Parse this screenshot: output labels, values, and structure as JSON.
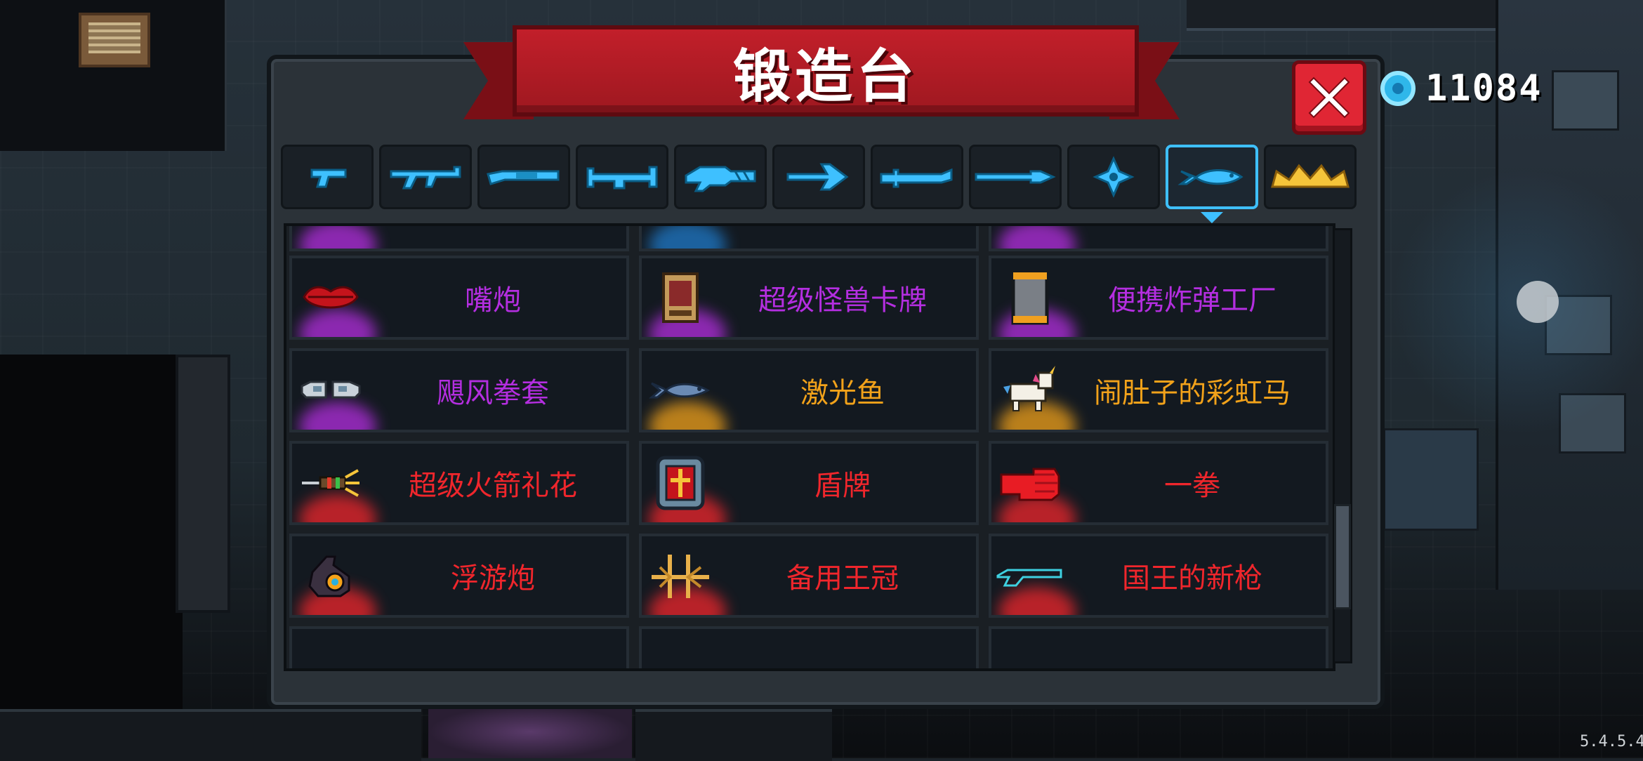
{
  "window": {
    "title": "锻造台"
  },
  "currency": {
    "gems": "11084",
    "color": "#2fb7ea"
  },
  "close_button": {
    "icon": "close-x-icon",
    "color": "#e02634"
  },
  "tabs": [
    {
      "icon": "pistol-icon",
      "selected": false
    },
    {
      "icon": "assault-rifle-icon",
      "selected": false
    },
    {
      "icon": "shotgun-icon",
      "selected": false
    },
    {
      "icon": "heavy-gun-icon",
      "selected": false
    },
    {
      "icon": "laser-rifle-icon",
      "selected": false
    },
    {
      "icon": "bow-icon",
      "selected": false
    },
    {
      "icon": "sword-icon",
      "selected": false
    },
    {
      "icon": "spear-icon",
      "selected": false
    },
    {
      "icon": "shuriken-icon",
      "selected": false
    },
    {
      "icon": "fish-weapon-icon",
      "selected": true
    },
    {
      "icon": "crown-icon",
      "selected": false
    }
  ],
  "rarity_colors": {
    "purple": "#b42ee0",
    "orange": "#f2a21a",
    "red": "#f0262c"
  },
  "items": [
    {
      "name": "嘴炮",
      "rarity": "purple",
      "icon": "lips-icon"
    },
    {
      "name": "超级怪兽卡牌",
      "rarity": "purple",
      "icon": "card-icon"
    },
    {
      "name": "便携炸弹工厂",
      "rarity": "purple",
      "icon": "bomb-factory-icon"
    },
    {
      "name": "飓风拳套",
      "rarity": "purple",
      "icon": "gloves-icon"
    },
    {
      "name": "激光鱼",
      "rarity": "orange",
      "icon": "fish-icon"
    },
    {
      "name": "闹肚子的彩虹马",
      "rarity": "orange",
      "icon": "unicorn-icon"
    },
    {
      "name": "超级火箭礼花",
      "rarity": "red",
      "icon": "rocket-firework-icon"
    },
    {
      "name": "盾牌",
      "rarity": "red",
      "icon": "shield-icon"
    },
    {
      "name": "一拳",
      "rarity": "red",
      "icon": "red-fist-icon"
    },
    {
      "name": "浮游炮",
      "rarity": "red",
      "icon": "floating-cannon-icon"
    },
    {
      "name": "备用王冠",
      "rarity": "red",
      "icon": "spare-crown-icon"
    },
    {
      "name": "国王的新枪",
      "rarity": "red",
      "icon": "invisible-gun-icon"
    }
  ],
  "version": "5.4.5.4"
}
